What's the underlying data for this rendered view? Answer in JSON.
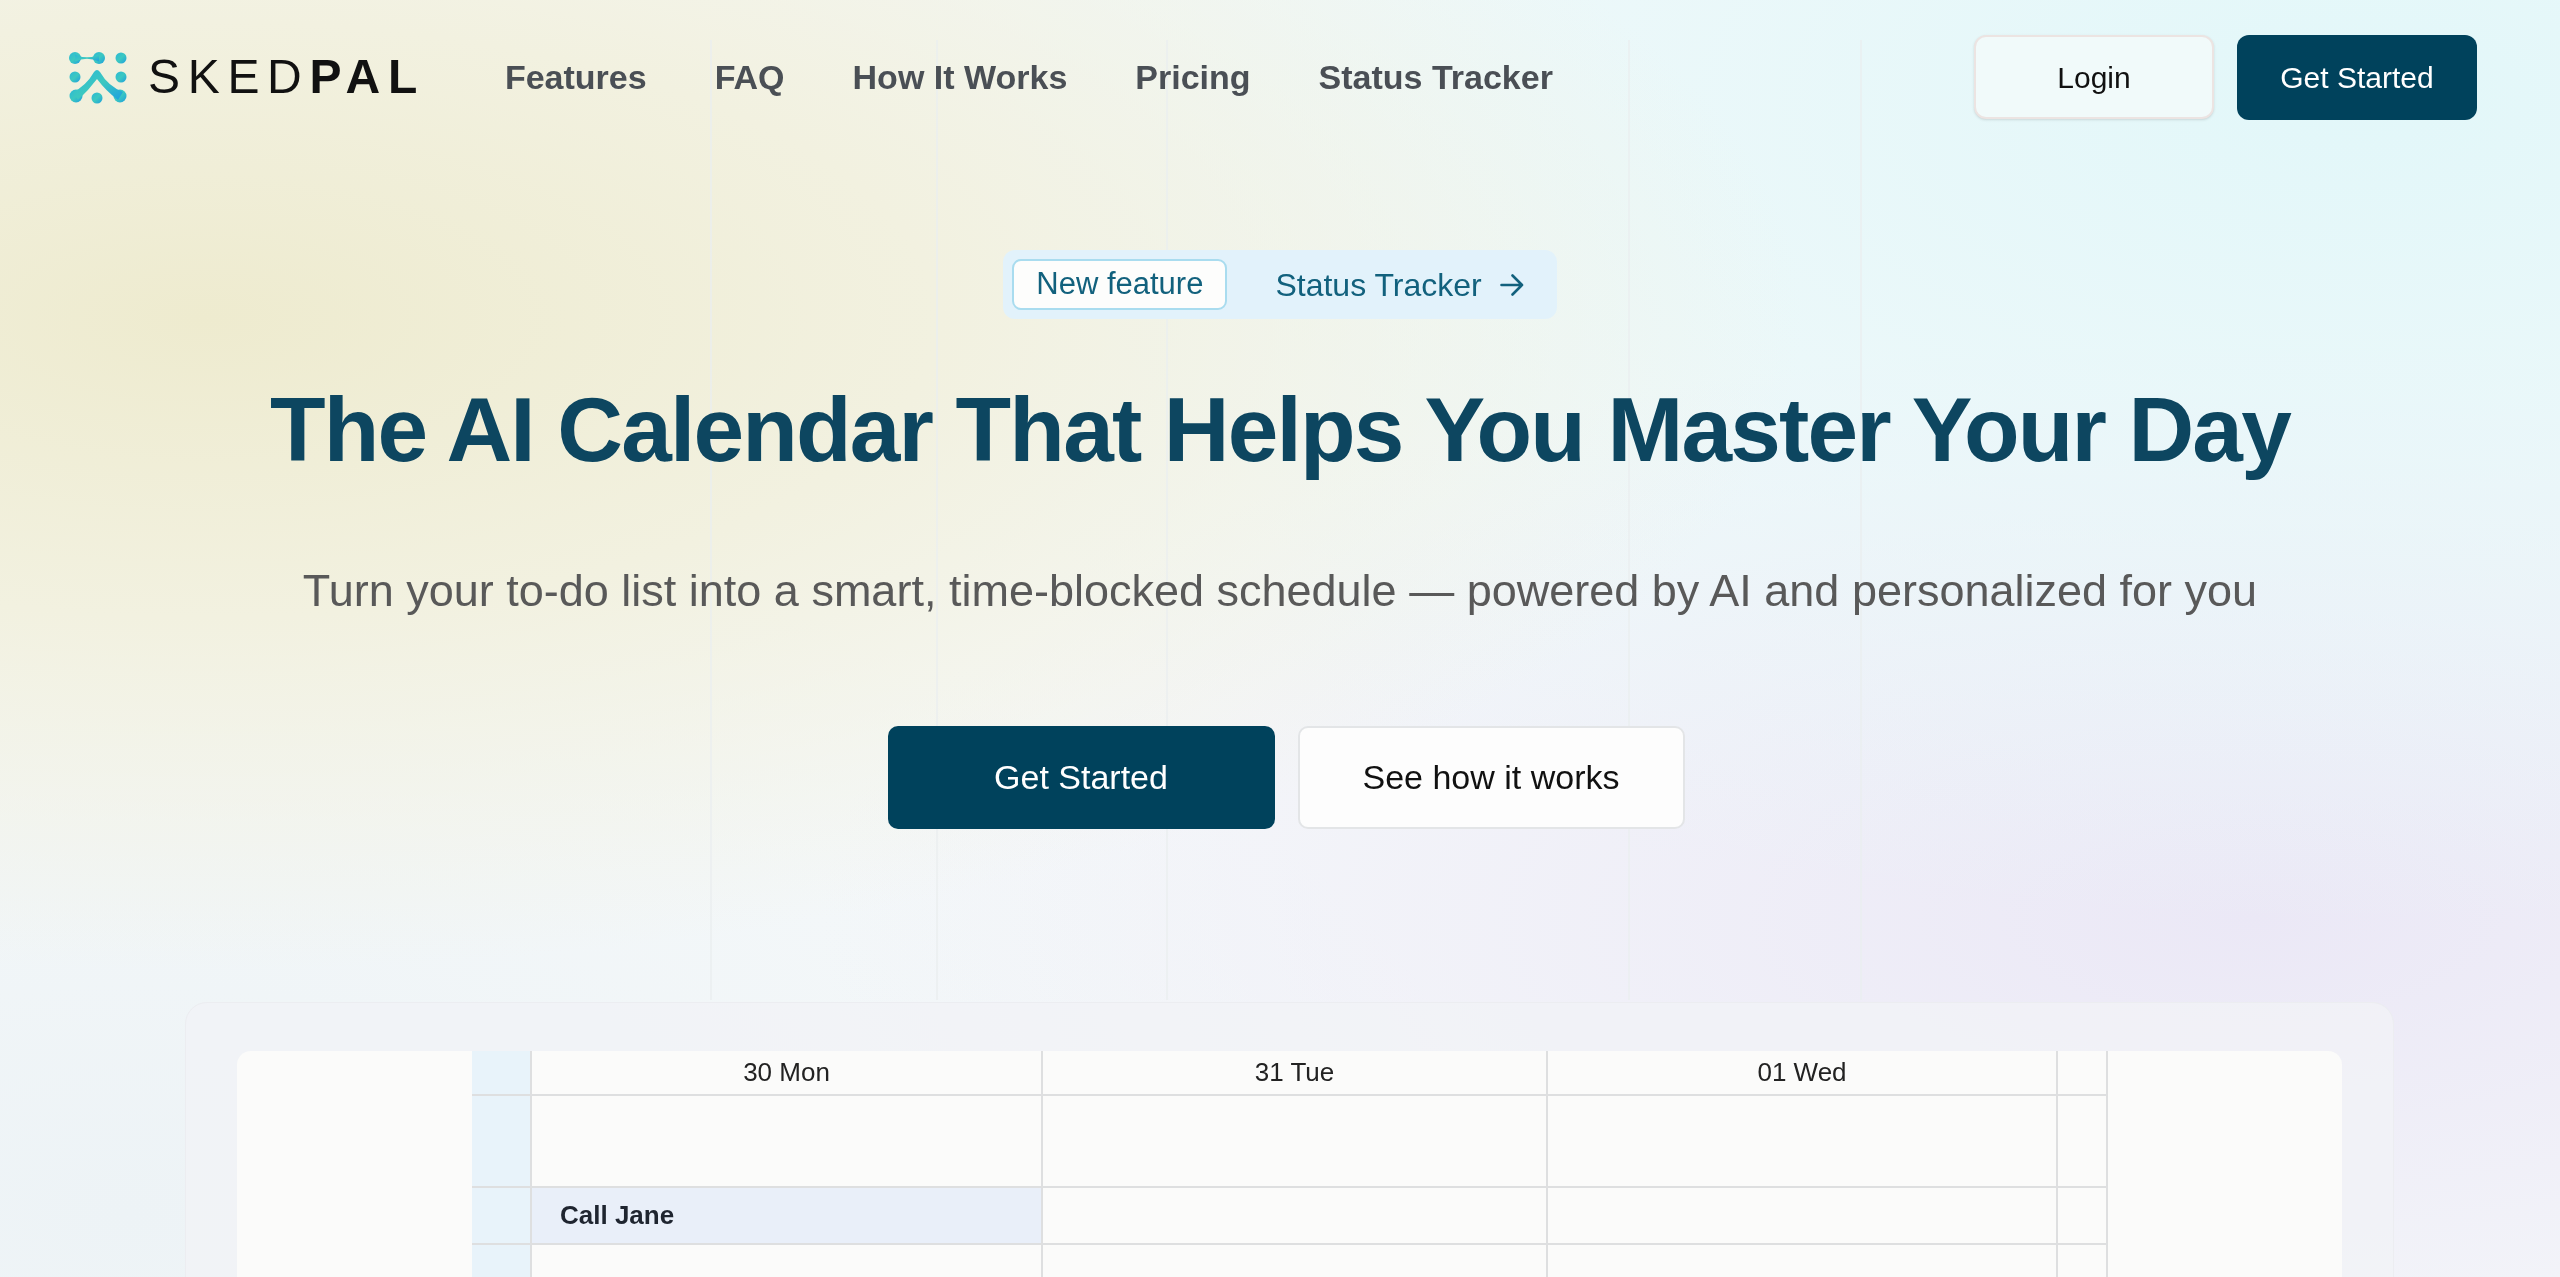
{
  "header": {
    "logo": {
      "text": "SKED**PAL**"
    },
    "nav": [
      {
        "label": "Features"
      },
      {
        "label": "FAQ"
      },
      {
        "label": "How It Works"
      },
      {
        "label": "Pricing"
      },
      {
        "label": "Status Tracker"
      }
    ],
    "actions": [
      {
        "label": "Login",
        "kind": "secondary"
      },
      {
        "label": "Get Started",
        "kind": "primary"
      }
    ]
  },
  "announcement": {
    "tag": "New feature",
    "link": "Status Tracker"
  },
  "hero": {
    "title": "The AI Calendar That Helps You Master Your Day",
    "subtitle": "Turn your to-do list into a smart, time-blocked schedule — powered by AI and personalized for you",
    "buttons": [
      {
        "label": "Get Started",
        "kind": "primary"
      },
      {
        "label": "See how it works",
        "kind": "secondary"
      }
    ]
  },
  "calendar": {
    "days": [
      {
        "label": "30 Mon",
        "events": [
          {
            "title": "Call Jane"
          }
        ]
      },
      {
        "label": "31 Tue"
      },
      {
        "label": "01 Wed"
      }
    ]
  }
}
